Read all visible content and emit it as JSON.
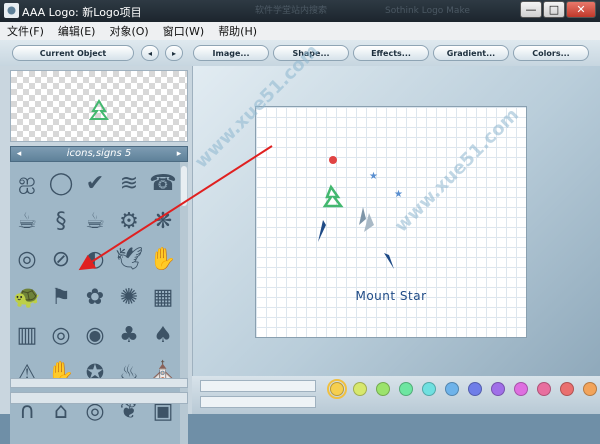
{
  "window": {
    "title": "AAA Logo: 新Logo项目",
    "faded_tab1": "软件学堂站内搜索",
    "faded_tab2": "Sothink Logo Make",
    "minimize": "—",
    "maximize": "□",
    "close": "✕"
  },
  "menu": [
    "文件(F)",
    "编辑(E)",
    "对象(O)",
    "窗口(W)",
    "帮助(H)"
  ],
  "toolbar": {
    "current_object": "Current Object",
    "prev": "◂",
    "next": "▸",
    "image": "Image...",
    "shape": "Shape...",
    "effects": "Effects...",
    "gradient": "Gradient...",
    "colors": "Colors..."
  },
  "library": {
    "name": "icons,signs 5",
    "prev": "◂",
    "next": "▸",
    "icons": [
      "swirl-trio-icon",
      "ring-icon",
      "swoosh-icon",
      "wave-lines-icon",
      "telephone-icon",
      "coffee-cup-icon",
      "s-curve-icon",
      "steaming-cup-icon",
      "gears-icon",
      "fan-icon",
      "spiral-icon",
      "no-sign-icon",
      "globe-icon",
      "dove-icon",
      "hand-icon",
      "turtle-icon",
      "family-icon",
      "flower-icon",
      "sun-face-icon",
      "brick-wall-icon",
      "barcode-icon",
      "concentric-icon",
      "maze-icon",
      "tree-icon",
      "pine-tree-icon",
      "warning-icon",
      "handshake-icon",
      "fire-badge-icon",
      "flames-icon",
      "church-icon",
      "arch-icon",
      "house-icon",
      "target-icon",
      "leaf-icon",
      "building-icon"
    ],
    "glyphs": [
      "ஐ",
      "◯",
      "✔",
      "≋",
      "☎",
      "☕",
      "§",
      "☕",
      "⚙",
      "❋",
      "◎",
      "⊘",
      "◐",
      "🕊",
      "✋",
      "🐢",
      "⚑",
      "✿",
      "✺",
      "▦",
      "▥",
      "◎",
      "◉",
      "♣",
      "♠",
      "⚠",
      "✋",
      "✪",
      "♨",
      "⛪",
      "∩",
      "⌂",
      "◎",
      "❦",
      "▣"
    ]
  },
  "canvas": {
    "logo_text": "Mount Star"
  },
  "palette": {
    "swatches": [
      "#f6cf4f",
      "#d7e86d",
      "#9be36c",
      "#6de6a1",
      "#6fe0e0",
      "#6eb3ea",
      "#6f7ee8",
      "#a06fe8",
      "#de6fe0",
      "#e86f9f",
      "#ea6f6f",
      "#f2a45b"
    ],
    "selected": 0
  },
  "colors": {
    "accent": "#1e4a86",
    "arrow": "#e02020"
  },
  "watermark": "软件学堂 www.xue51.com"
}
